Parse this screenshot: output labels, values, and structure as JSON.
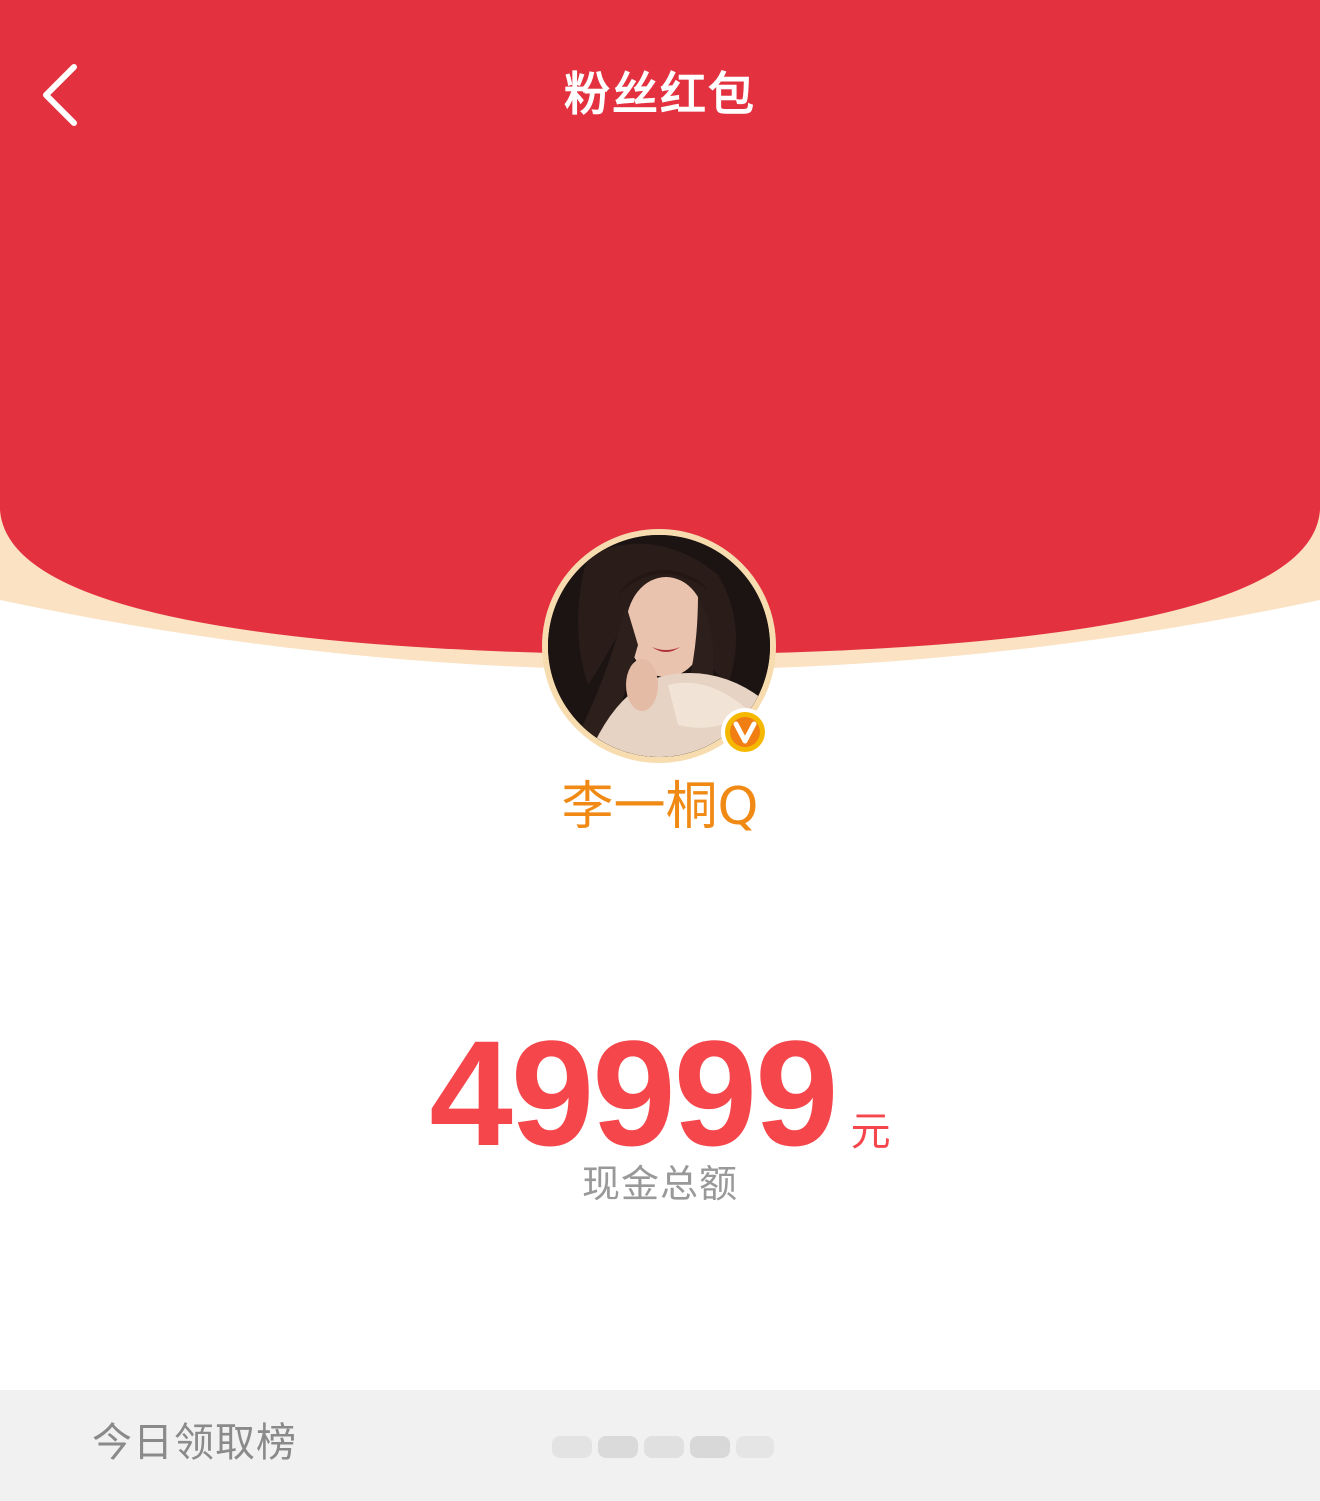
{
  "header": {
    "title": "粉丝红包",
    "back_icon": "chevron-left-icon"
  },
  "colors": {
    "header_red": "#E4313F",
    "curve_cream": "#FBE2C2",
    "name_orange": "#F08A14",
    "amount_red": "#F5464B",
    "badge_gold": "#F5B800",
    "caption_gray": "#999999",
    "bar_gray": "#F1F1F1"
  },
  "profile": {
    "name": "李一桐Q",
    "verified_icon": "verified-v-badge-icon"
  },
  "cash": {
    "amount": "49999",
    "unit": "元",
    "caption": "现金总额"
  },
  "ranking": {
    "title": "今日领取榜"
  }
}
